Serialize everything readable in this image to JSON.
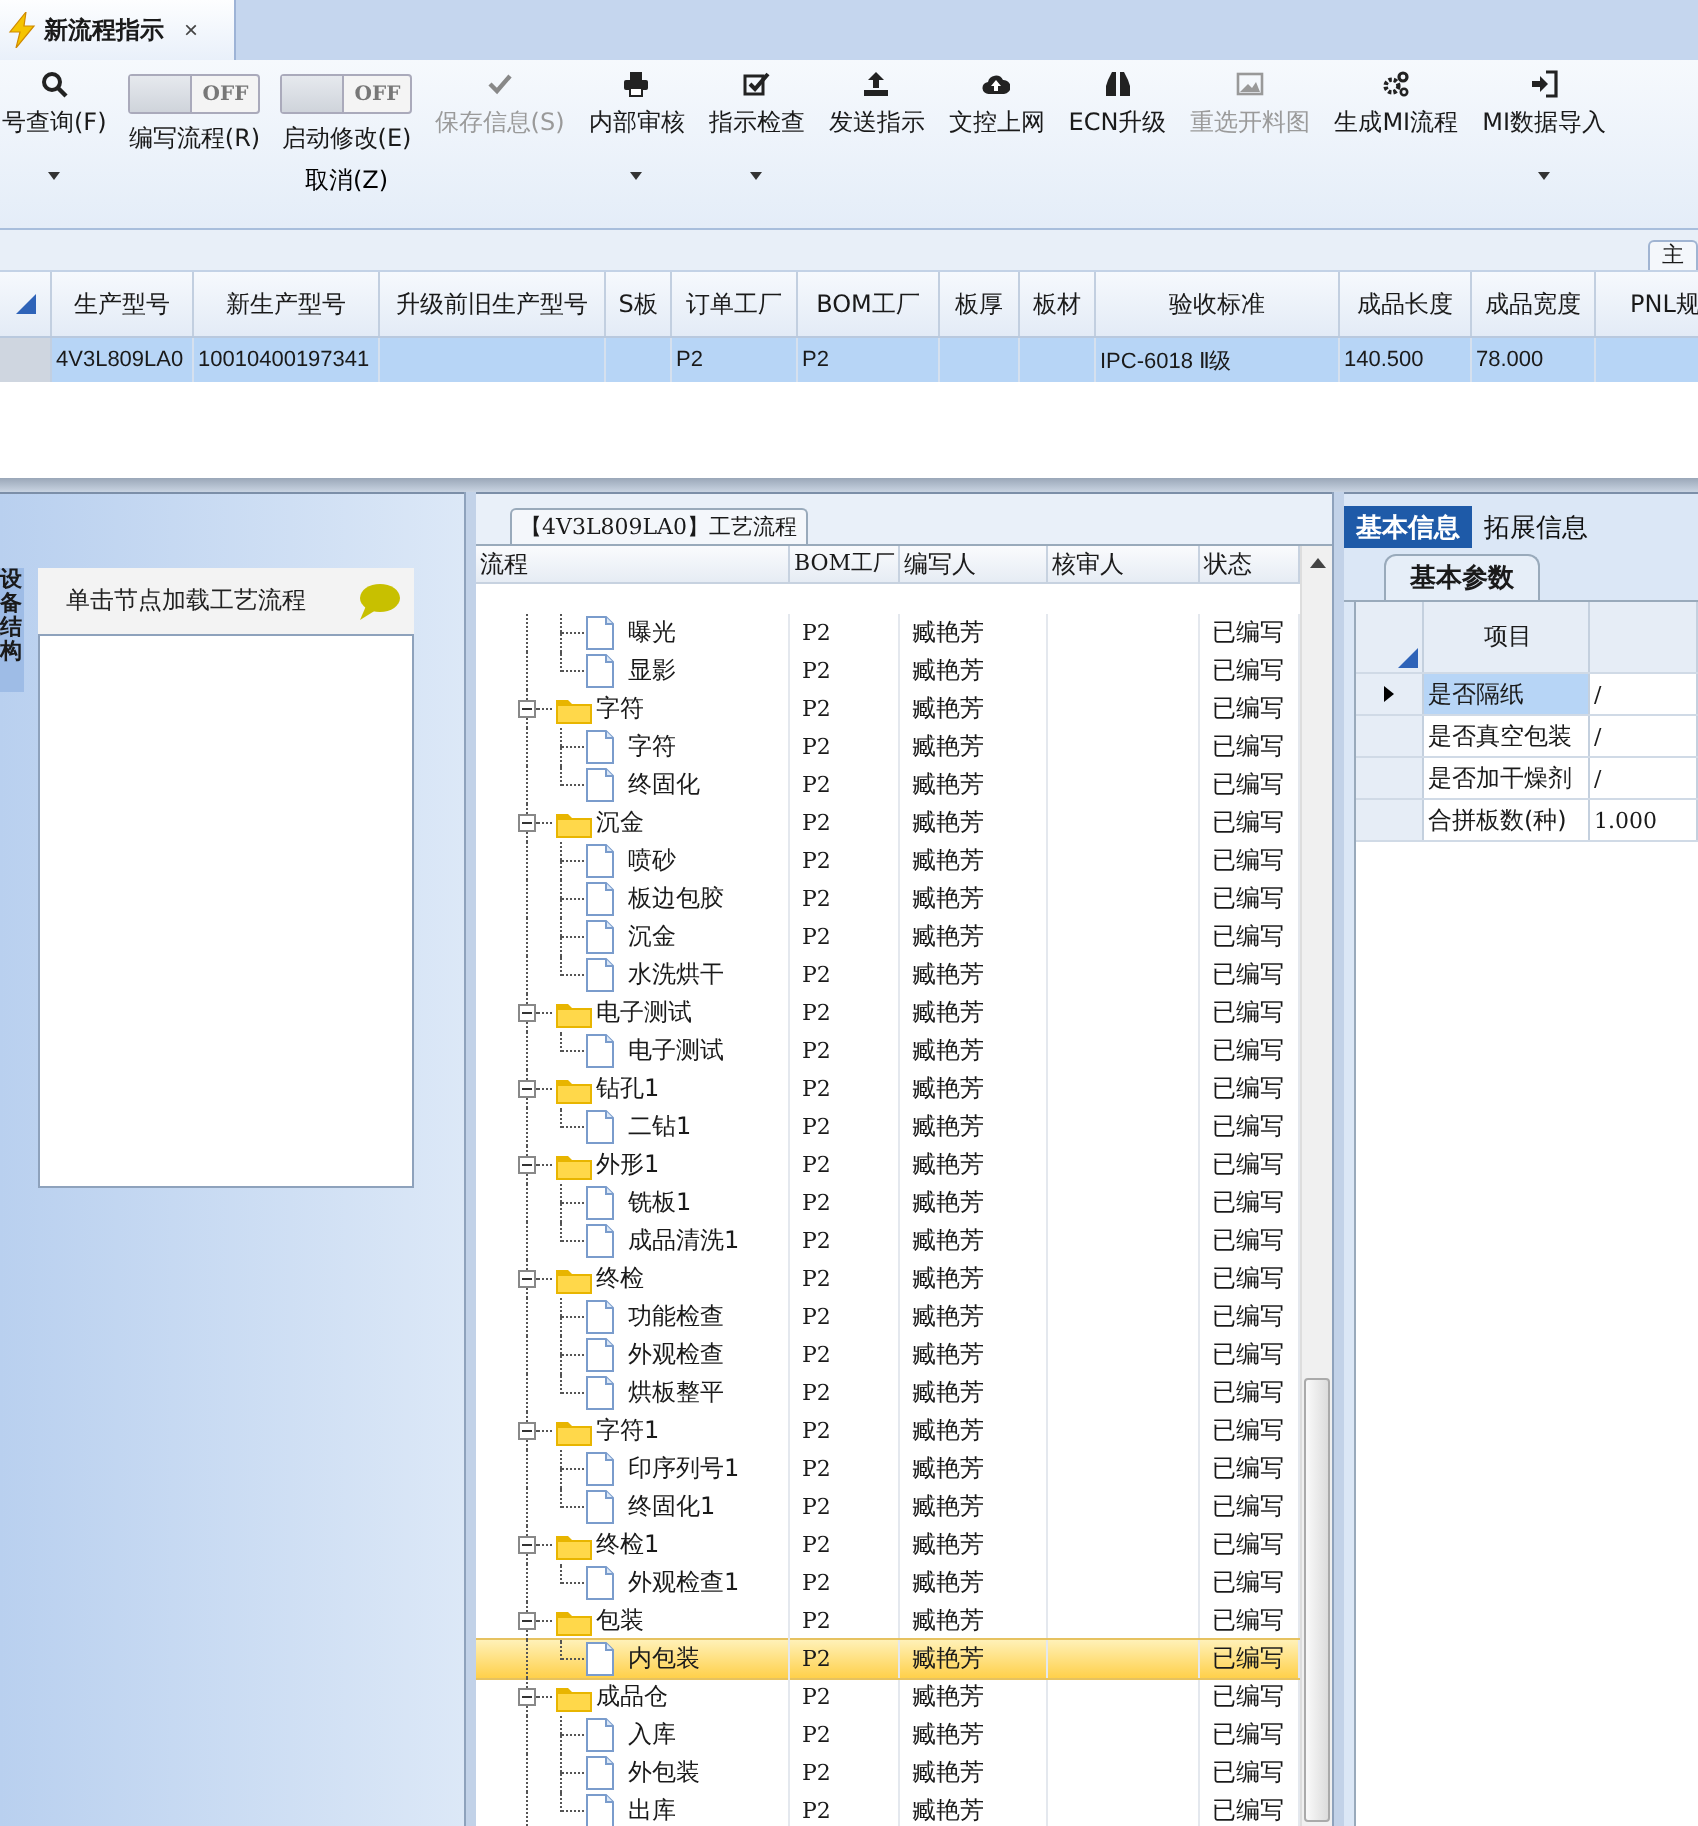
{
  "document_tab": {
    "label": "新流程指示",
    "close": "×",
    "selected": true
  },
  "ribbon": [
    {
      "kind": "button",
      "label": "号查询(F)",
      "disabled": false,
      "dropdown": true
    },
    {
      "kind": "toggle",
      "label": "编写流程(R)",
      "on": false,
      "state_text": "OFF"
    },
    {
      "kind": "toggle",
      "label": "启动修改(E)",
      "sublabel": "取消(Z)",
      "on": false,
      "state_text": "OFF"
    },
    {
      "kind": "button",
      "label": "保存信息(S)",
      "disabled": true,
      "dropdown": false
    },
    {
      "kind": "button",
      "label": "内部审核",
      "disabled": false,
      "dropdown": true
    },
    {
      "kind": "button",
      "label": "指示检查",
      "disabled": false,
      "dropdown": true
    },
    {
      "kind": "button",
      "label": "发送指示",
      "disabled": false,
      "dropdown": false
    },
    {
      "kind": "button",
      "label": "文控上网",
      "disabled": false,
      "dropdown": false
    },
    {
      "kind": "button",
      "label": "ECN升级",
      "disabled": false,
      "dropdown": false
    },
    {
      "kind": "button",
      "label": "重选开料图",
      "disabled": true,
      "dropdown": false
    },
    {
      "kind": "button",
      "label": "生成MI流程",
      "disabled": false,
      "dropdown": false
    },
    {
      "kind": "button",
      "label": "MI数据导入",
      "disabled": false,
      "dropdown": true
    }
  ],
  "side_tab": {
    "label": "主"
  },
  "products": {
    "columns": [
      "生产型号",
      "新生产型号",
      "升级前旧生产型号",
      "S板",
      "订单工厂",
      "BOM工厂",
      "板厚",
      "板材",
      "验收标准",
      "成品长度",
      "成品宽度",
      "PNL规"
    ],
    "rows": [
      {
        "selected": true,
        "cells": [
          "4V3L809LA0",
          "10010400197341",
          null,
          null,
          "P2",
          "P2",
          null,
          null,
          "IPC-6018 Ⅱ级",
          "140.500",
          "78.000",
          null
        ]
      }
    ]
  },
  "left_panel": {
    "vertical_tab": "设备结构",
    "header": "单击节点加载工艺流程"
  },
  "process": {
    "title": "【4V3L809LA0】工艺流程",
    "columns": [
      "流程",
      "BOM工厂",
      "编写人",
      "核审人",
      "状态"
    ],
    "groups": [
      {
        "children": [
          {
            "name": "曝光",
            "bom": "P2",
            "writer": "臧艳芳",
            "status": "已编写",
            "selected": false
          },
          {
            "name": "显影",
            "bom": "P2",
            "writer": "臧艳芳",
            "status": "已编写",
            "selected": false
          }
        ]
      },
      {
        "name": "字符",
        "bom": "P2",
        "writer": "臧艳芳",
        "status": "已编写",
        "expanded": true,
        "selected": false,
        "children": [
          {
            "name": "字符",
            "bom": "P2",
            "writer": "臧艳芳",
            "status": "已编写",
            "selected": false
          },
          {
            "name": "终固化",
            "bom": "P2",
            "writer": "臧艳芳",
            "status": "已编写",
            "selected": false
          }
        ]
      },
      {
        "name": "沉金",
        "bom": "P2",
        "writer": "臧艳芳",
        "status": "已编写",
        "expanded": true,
        "selected": false,
        "children": [
          {
            "name": "喷砂",
            "bom": "P2",
            "writer": "臧艳芳",
            "status": "已编写",
            "selected": false
          },
          {
            "name": "板边包胶",
            "bom": "P2",
            "writer": "臧艳芳",
            "status": "已编写",
            "selected": false
          },
          {
            "name": "沉金",
            "bom": "P2",
            "writer": "臧艳芳",
            "status": "已编写",
            "selected": false
          },
          {
            "name": "水洗烘干",
            "bom": "P2",
            "writer": "臧艳芳",
            "status": "已编写",
            "selected": false
          }
        ]
      },
      {
        "name": "电子测试",
        "bom": "P2",
        "writer": "臧艳芳",
        "status": "已编写",
        "expanded": true,
        "selected": false,
        "children": [
          {
            "name": "电子测试",
            "bom": "P2",
            "writer": "臧艳芳",
            "status": "已编写",
            "selected": false
          }
        ]
      },
      {
        "name": "钻孔1",
        "bom": "P2",
        "writer": "臧艳芳",
        "status": "已编写",
        "expanded": true,
        "selected": false,
        "children": [
          {
            "name": "二钻1",
            "bom": "P2",
            "writer": "臧艳芳",
            "status": "已编写",
            "selected": false
          }
        ]
      },
      {
        "name": "外形1",
        "bom": "P2",
        "writer": "臧艳芳",
        "status": "已编写",
        "expanded": true,
        "selected": false,
        "children": [
          {
            "name": "铣板1",
            "bom": "P2",
            "writer": "臧艳芳",
            "status": "已编写",
            "selected": false
          },
          {
            "name": "成品清洗1",
            "bom": "P2",
            "writer": "臧艳芳",
            "status": "已编写",
            "selected": false
          }
        ]
      },
      {
        "name": "终检",
        "bom": "P2",
        "writer": "臧艳芳",
        "status": "已编写",
        "expanded": true,
        "selected": false,
        "children": [
          {
            "name": "功能检查",
            "bom": "P2",
            "writer": "臧艳芳",
            "status": "已编写",
            "selected": false
          },
          {
            "name": "外观检查",
            "bom": "P2",
            "writer": "臧艳芳",
            "status": "已编写",
            "selected": false
          },
          {
            "name": "烘板整平",
            "bom": "P2",
            "writer": "臧艳芳",
            "status": "已编写",
            "selected": false
          }
        ]
      },
      {
        "name": "字符1",
        "bom": "P2",
        "writer": "臧艳芳",
        "status": "已编写",
        "expanded": true,
        "selected": false,
        "children": [
          {
            "name": "印序列号1",
            "bom": "P2",
            "writer": "臧艳芳",
            "status": "已编写",
            "selected": false
          },
          {
            "name": "终固化1",
            "bom": "P2",
            "writer": "臧艳芳",
            "status": "已编写",
            "selected": false
          }
        ]
      },
      {
        "name": "终检1",
        "bom": "P2",
        "writer": "臧艳芳",
        "status": "已编写",
        "expanded": true,
        "selected": false,
        "children": [
          {
            "name": "外观检查1",
            "bom": "P2",
            "writer": "臧艳芳",
            "status": "已编写",
            "selected": false
          }
        ]
      },
      {
        "name": "包装",
        "bom": "P2",
        "writer": "臧艳芳",
        "status": "已编写",
        "expanded": true,
        "selected": false,
        "children": [
          {
            "name": "内包装",
            "bom": "P2",
            "writer": "臧艳芳",
            "status": "已编写",
            "selected": true
          }
        ]
      },
      {
        "name": "成品仓",
        "bom": "P2",
        "writer": "臧艳芳",
        "status": "已编写",
        "expanded": true,
        "selected": false,
        "children": [
          {
            "name": "入库",
            "bom": "P2",
            "writer": "臧艳芳",
            "status": "已编写",
            "selected": false
          },
          {
            "name": "外包装",
            "bom": "P2",
            "writer": "臧艳芳",
            "status": "已编写",
            "selected": false
          },
          {
            "name": "出库",
            "bom": "P2",
            "writer": "臧艳芳",
            "status": "已编写",
            "selected": false
          }
        ]
      }
    ]
  },
  "info_tabs": [
    {
      "label": "基本信息",
      "selected": true
    },
    {
      "label": "拓展信息",
      "selected": false
    }
  ],
  "sub_tab": {
    "label": "基本参数"
  },
  "params": {
    "column": "项目",
    "rows": [
      {
        "item": "是否隔纸",
        "value": "/",
        "selected": true
      },
      {
        "item": "是否真空包装",
        "value": "/",
        "selected": false
      },
      {
        "item": "是否加干燥剂",
        "value": "/",
        "selected": false
      },
      {
        "item": "合拼板数(种)",
        "value": "1.000",
        "selected": false
      }
    ]
  }
}
